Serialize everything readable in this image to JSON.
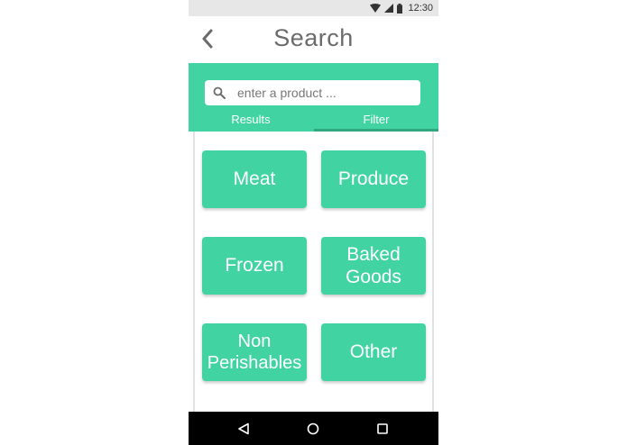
{
  "status_bar": {
    "time": "12:30",
    "icons": [
      "wifi-icon",
      "signal-icon",
      "battery-icon"
    ]
  },
  "app_bar": {
    "title": "Search",
    "back_icon": "chevron-left-icon"
  },
  "search": {
    "placeholder": "enter a product ...",
    "value": "",
    "icon": "search-icon"
  },
  "tabs": [
    {
      "label": "Results",
      "selected": false
    },
    {
      "label": "Filter",
      "selected": true
    }
  ],
  "categories": [
    {
      "label": "Meat"
    },
    {
      "label": "Produce"
    },
    {
      "label": "Frozen"
    },
    {
      "label": "Baked\nGoods"
    },
    {
      "label": "Non\nPerishables"
    },
    {
      "label": "Other"
    }
  ],
  "nav_bar": {
    "icons": [
      "back-triangle-icon",
      "home-circle-icon",
      "recents-square-icon"
    ]
  },
  "colors": {
    "accent": "#42d3a3",
    "tab_indicator": "#2fa882",
    "title_text": "#6b6b6b"
  }
}
